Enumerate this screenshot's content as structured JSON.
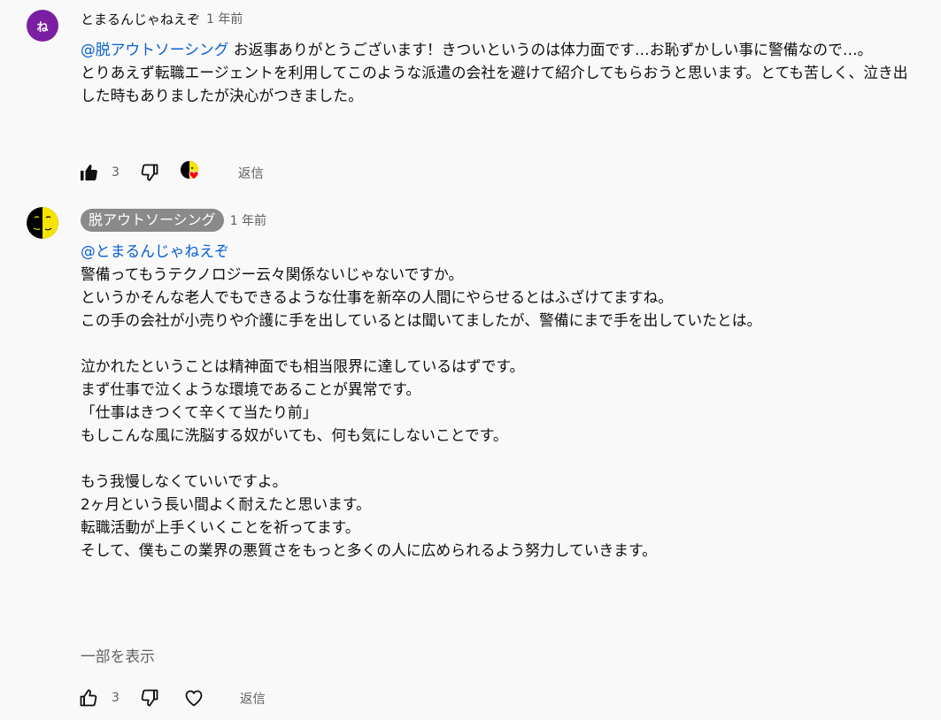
{
  "comments": [
    {
      "avatar_letter": "ね",
      "author": "とまるんじゃねえぞ",
      "time": "1 年前",
      "mention": "@脱アウトソーシング",
      "text_after_mention": " お返事ありがとうございます！きついというのは体力面です…お恥ずかしい事に警備なので…。",
      "text_rest": "とりあえず転職エージェントを利用してこのような派遣の会社を避けて紹介してもらおうと思います。とても苦しく、泣き出した時もありましたが決心がつきました。",
      "likes": "3",
      "reply_label": "返信"
    },
    {
      "author": "脱アウトソーシング",
      "time": "1 年前",
      "mention": "@とまるんじゃねえぞ",
      "lines": [
        "警備ってもうテクノロジー云々関係ないじゃないですか。",
        "というかそんな老人でもできるような仕事を新卒の人間にやらせるとはふざけてますね。",
        "この手の会社が小売りや介護に手を出しているとは聞いてましたが、警備にまで手を出していたとは。",
        "",
        "泣かれたということは精神面でも相当限界に達しているはずです。",
        "まず仕事で泣くような環境であることが異常です。",
        "「仕事はきつくて辛くて当たり前」",
        "もしこんな風に洗脳する奴がいても、何も気にしないことです。",
        "",
        "もう我慢しなくていいですよ。",
        "2ヶ月という長い間よく耐えたと思います。",
        "転職活動が上手くいくことを祈ってます。",
        "そして、僕もこの業界の悪質さをもっと多くの人に広められるよう努力していきます。"
      ],
      "show_more": "一部を表示",
      "likes": "3",
      "reply_label": "返信"
    }
  ],
  "colors": {
    "background": "#f9f9f9",
    "mention": "#065fd4",
    "avatar_purple": "#7b1fa2",
    "badge_gray": "#8a8a8a",
    "heart_red": "#ff0000"
  },
  "icons": [
    "thumbs-up-filled-icon",
    "thumbs-down-icon",
    "creator-heart-icon",
    "thumbs-up-outline-icon",
    "heart-outline-icon"
  ]
}
